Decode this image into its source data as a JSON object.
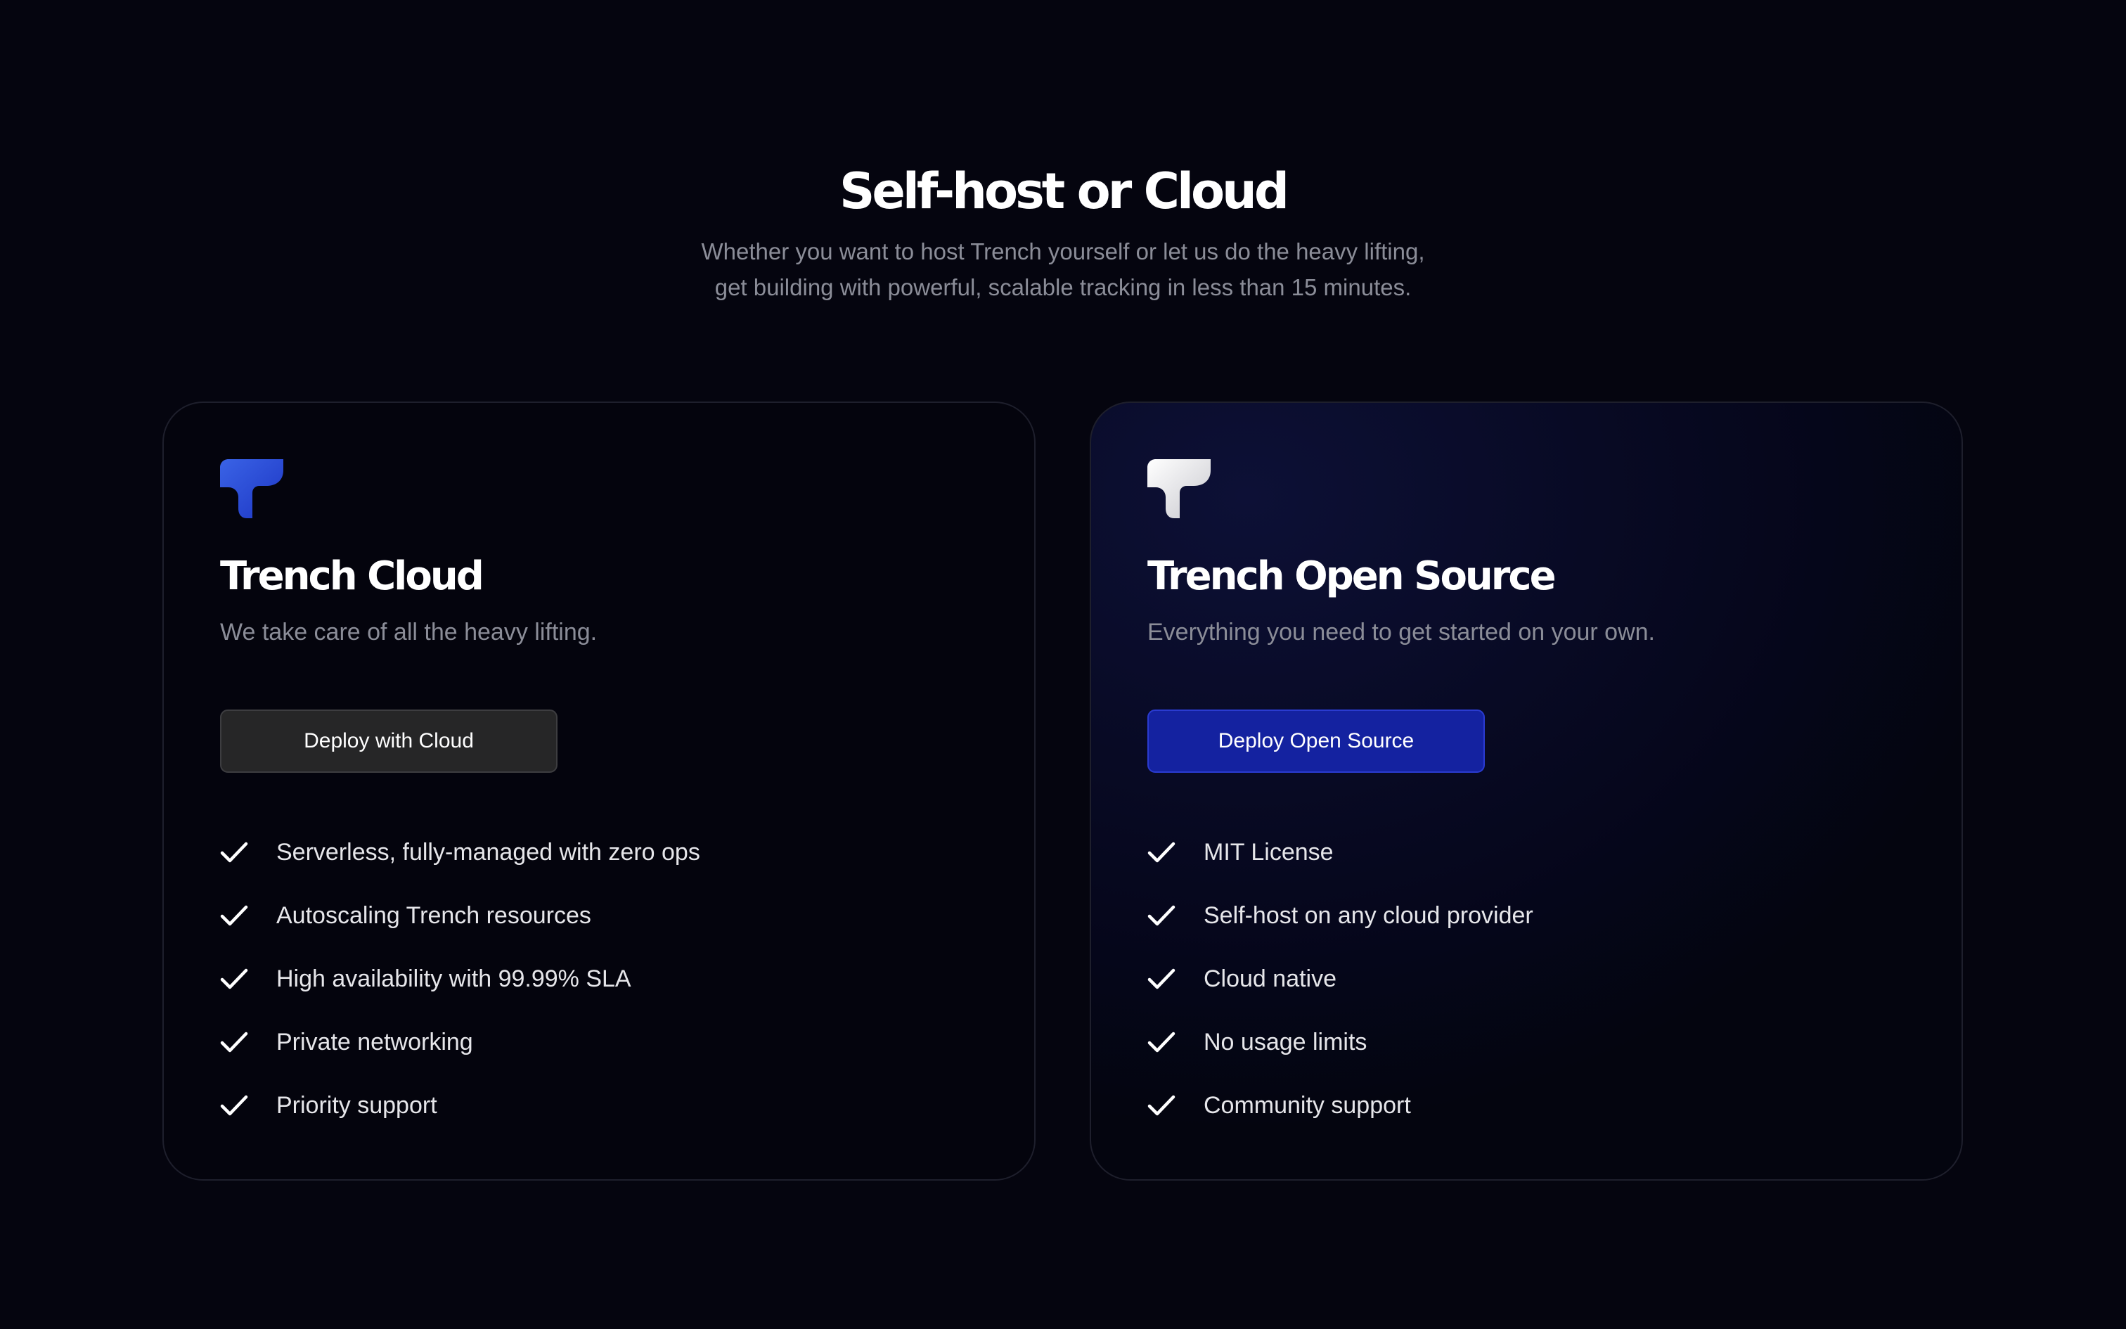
{
  "hero": {
    "title": "Self-host or Cloud",
    "subtitle_line1": "Whether you want to host Trench yourself or let us do the heavy lifting,",
    "subtitle_line2": "get building with powerful, scalable tracking in less than 15 minutes."
  },
  "cards": [
    {
      "logo_icon": "trench-logo-icon",
      "logo_color": "#2a4fd6",
      "title": "Trench Cloud",
      "subtitle": "We take care of all the heavy lifting.",
      "button_label": "Deploy with Cloud",
      "button_color": "#262627",
      "features": [
        "Serverless, fully-managed with zero ops",
        "Autoscaling Trench resources",
        "High availability with 99.99% SLA",
        "Private networking",
        "Priority support"
      ]
    },
    {
      "logo_icon": "trench-logo-icon",
      "logo_color": "#e9e9ec",
      "title": "Trench Open Source",
      "subtitle": "Everything you need to get started on your own.",
      "button_label": "Deploy Open Source",
      "button_color": "#1422a0",
      "features": [
        "MIT License",
        "Self-host on any cloud provider",
        "Cloud native",
        "No usage limits",
        "Community support"
      ]
    }
  ],
  "icons": {
    "check": "check-icon"
  }
}
